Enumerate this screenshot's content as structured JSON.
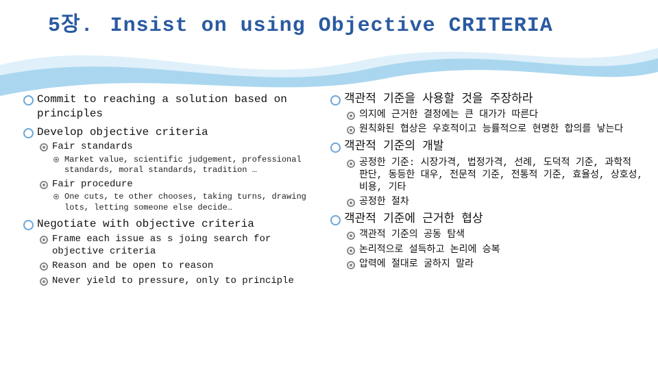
{
  "chapter": "5장.",
  "title": "Insist on using Objective CRITERIA",
  "left": {
    "items": [
      {
        "text": "Commit to reaching a solution based on principles"
      },
      {
        "text": "Develop objective criteria",
        "children": [
          {
            "text": "Fair standards",
            "children": [
              {
                "text": "Market value, scientific judgement, professional standards, moral standards, tradition …"
              }
            ]
          },
          {
            "text": "Fair procedure",
            "children": [
              {
                "text": "One cuts, te other chooses, taking turns, drawing lots, letting someone else decide…"
              }
            ]
          }
        ]
      },
      {
        "text": "Negotiate with objective criteria",
        "children": [
          {
            "text": "Frame each issue as s joing search for objective criteria"
          },
          {
            "text": "Reason and be open to reason"
          },
          {
            "text": "Never yield to pressure, only to principle"
          }
        ]
      }
    ]
  },
  "right": {
    "items": [
      {
        "text": "객관적 기준을 사용할 것을 주장하라",
        "children": [
          {
            "text": "의지에 근거한 결정에는 큰 대가가 따른다"
          },
          {
            "text": "원칙화된 협상은 우호적이고 능률적으로 현명한 합의를 낳는다"
          }
        ]
      },
      {
        "text": "객관적 기준의 개발",
        "children": [
          {
            "text": "공정한 기준: 시장가격, 법정가격, 선례, 도덕적 기준, 과학적 판단, 동등한 대우, 전문적 기준, 전통적 기준, 효율성, 상호성, 비용, 기타"
          },
          {
            "text": "공정한 절차"
          }
        ]
      },
      {
        "text": "객관적 기준에 근거한 협상",
        "children": [
          {
            "text": "객관적 기준의 공동 탐색"
          },
          {
            "text": "논리적으로 설득하고 논리에 승복"
          },
          {
            "text": "압력에 절대로 굴하지 말라"
          }
        ]
      }
    ]
  }
}
